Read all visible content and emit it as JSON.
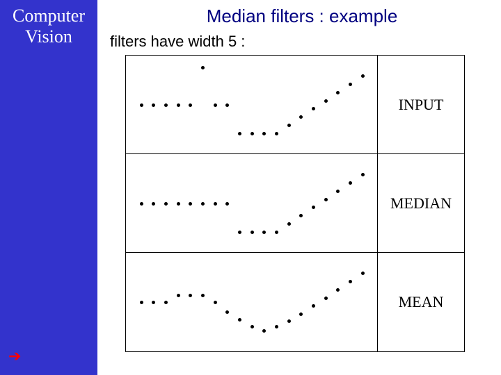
{
  "sidebar": {
    "title_line1": "Computer",
    "title_line2": "Vision",
    "arrow_glyph": "➔"
  },
  "slide": {
    "title": "Median filters : example",
    "subtitle": "filters have width 5 :"
  },
  "panels": [
    {
      "label": "INPUT"
    },
    {
      "label": "MEDIAN"
    },
    {
      "label": "MEAN"
    }
  ],
  "chart_data": {
    "type": "scatter",
    "note": "Three stacked 1D signals (y vs x index). Filter width = 5. Values estimated from image on arbitrary vertical scale 0-100.",
    "x": [
      1,
      2,
      3,
      4,
      5,
      6,
      7,
      8,
      9,
      10,
      11,
      12,
      13,
      14,
      15,
      16,
      17,
      18,
      19
    ],
    "series": [
      {
        "name": "INPUT",
        "values": [
          50,
          50,
          50,
          50,
          50,
          95,
          50,
          50,
          15,
          15,
          15,
          15,
          25,
          35,
          45,
          55,
          65,
          75,
          85
        ]
      },
      {
        "name": "MEDIAN",
        "values": [
          50,
          50,
          50,
          50,
          50,
          50,
          50,
          50,
          15,
          15,
          15,
          15,
          25,
          35,
          45,
          55,
          65,
          75,
          85
        ]
      },
      {
        "name": "MEAN",
        "values": [
          50,
          50,
          50,
          58,
          58,
          58,
          50,
          38,
          28,
          20,
          15,
          20,
          27,
          35,
          45,
          55,
          65,
          75,
          85
        ]
      }
    ],
    "xlim": [
      1,
      19
    ],
    "ylim": [
      0,
      100
    ]
  }
}
